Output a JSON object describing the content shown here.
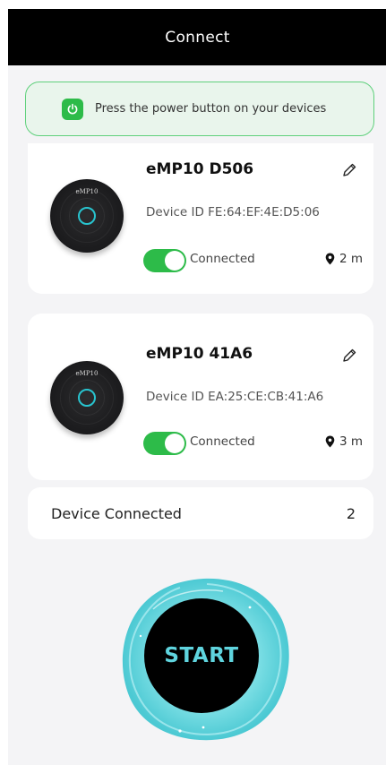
{
  "header": {
    "title": "Connect"
  },
  "notice": {
    "text": "Press the power button on your devices"
  },
  "devices": [
    {
      "name": "eMP10 D506",
      "device_id": "Device ID FE:64:EF:4E:D5:06",
      "status": "Connected",
      "distance": "2 m",
      "brand": "eMP10",
      "connected": true
    },
    {
      "name": "eMP10 41A6",
      "device_id": "Device ID EA:25:CE:CB:41:A6",
      "status": "Connected",
      "distance": "3 m",
      "brand": "eMP10",
      "connected": true
    }
  ],
  "summary": {
    "label": "Device Connected",
    "count": "2"
  },
  "start": {
    "label": "START"
  },
  "colors": {
    "accent_green": "#2dbb49",
    "start_teal": "#5fd4de",
    "header_bg": "#000000"
  },
  "icons": {
    "power": "power-icon",
    "edit": "pencil-icon",
    "location": "location-pin-icon"
  }
}
